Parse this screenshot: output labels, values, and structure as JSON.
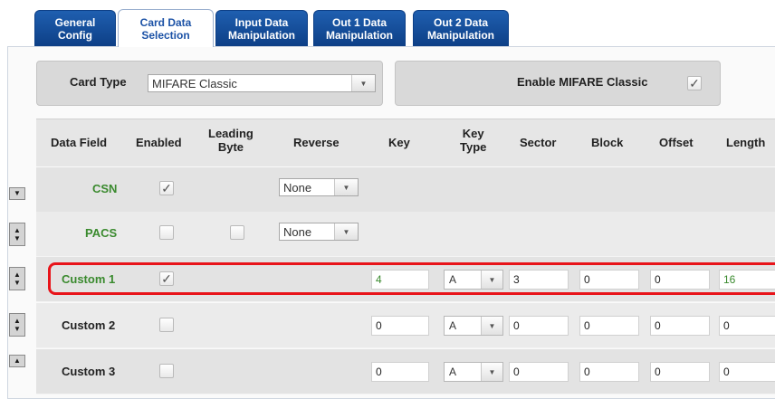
{
  "tabs": [
    {
      "label": "General\nConfig"
    },
    {
      "label": "Card Data\nSelection"
    },
    {
      "label": "Input Data\nManipulation"
    },
    {
      "label": "Out 1 Data\nManipulation"
    },
    {
      "label": "Out 2 Data\nManipulation"
    }
  ],
  "card_type": {
    "label": "Card Type",
    "value": "MIFARE Classic"
  },
  "enable": {
    "label": "Enable MIFARE Classic",
    "checked": true
  },
  "columns": {
    "data_field": "Data Field",
    "enabled": "Enabled",
    "leading_byte": "Leading\nByte",
    "reverse": "Reverse",
    "key": "Key",
    "key_type": "Key\nType",
    "sector": "Sector",
    "block": "Block",
    "offset": "Offset",
    "length": "Length"
  },
  "rows": [
    {
      "name": "CSN",
      "enabled": "✓",
      "reverse": "None"
    },
    {
      "name": "PACS",
      "enabled": "",
      "leading_byte": "",
      "reverse": "None"
    },
    {
      "name": "Custom 1",
      "enabled": "✓",
      "key": "4",
      "key_type": "A",
      "sector": "3",
      "block": "0",
      "offset": "0",
      "length": "16"
    },
    {
      "name": "Custom 2",
      "enabled": "",
      "key": "0",
      "key_type": "A",
      "sector": "0",
      "block": "0",
      "offset": "0",
      "length": "0"
    },
    {
      "name": "Custom 3",
      "enabled": "",
      "key": "0",
      "key_type": "A",
      "sector": "0",
      "block": "0",
      "offset": "0",
      "length": "0"
    }
  ],
  "icons": {
    "dropdown": "chevron-down-icon",
    "move_up": "arrow-up-icon",
    "move_down": "arrow-down-icon",
    "check": "checkmark-icon"
  },
  "colors": {
    "tab_active_text": "#1c52a6",
    "tab_inactive_bg": "#1f5fb0",
    "highlight": "#e8141a",
    "green_text": "#3a8a2e"
  }
}
